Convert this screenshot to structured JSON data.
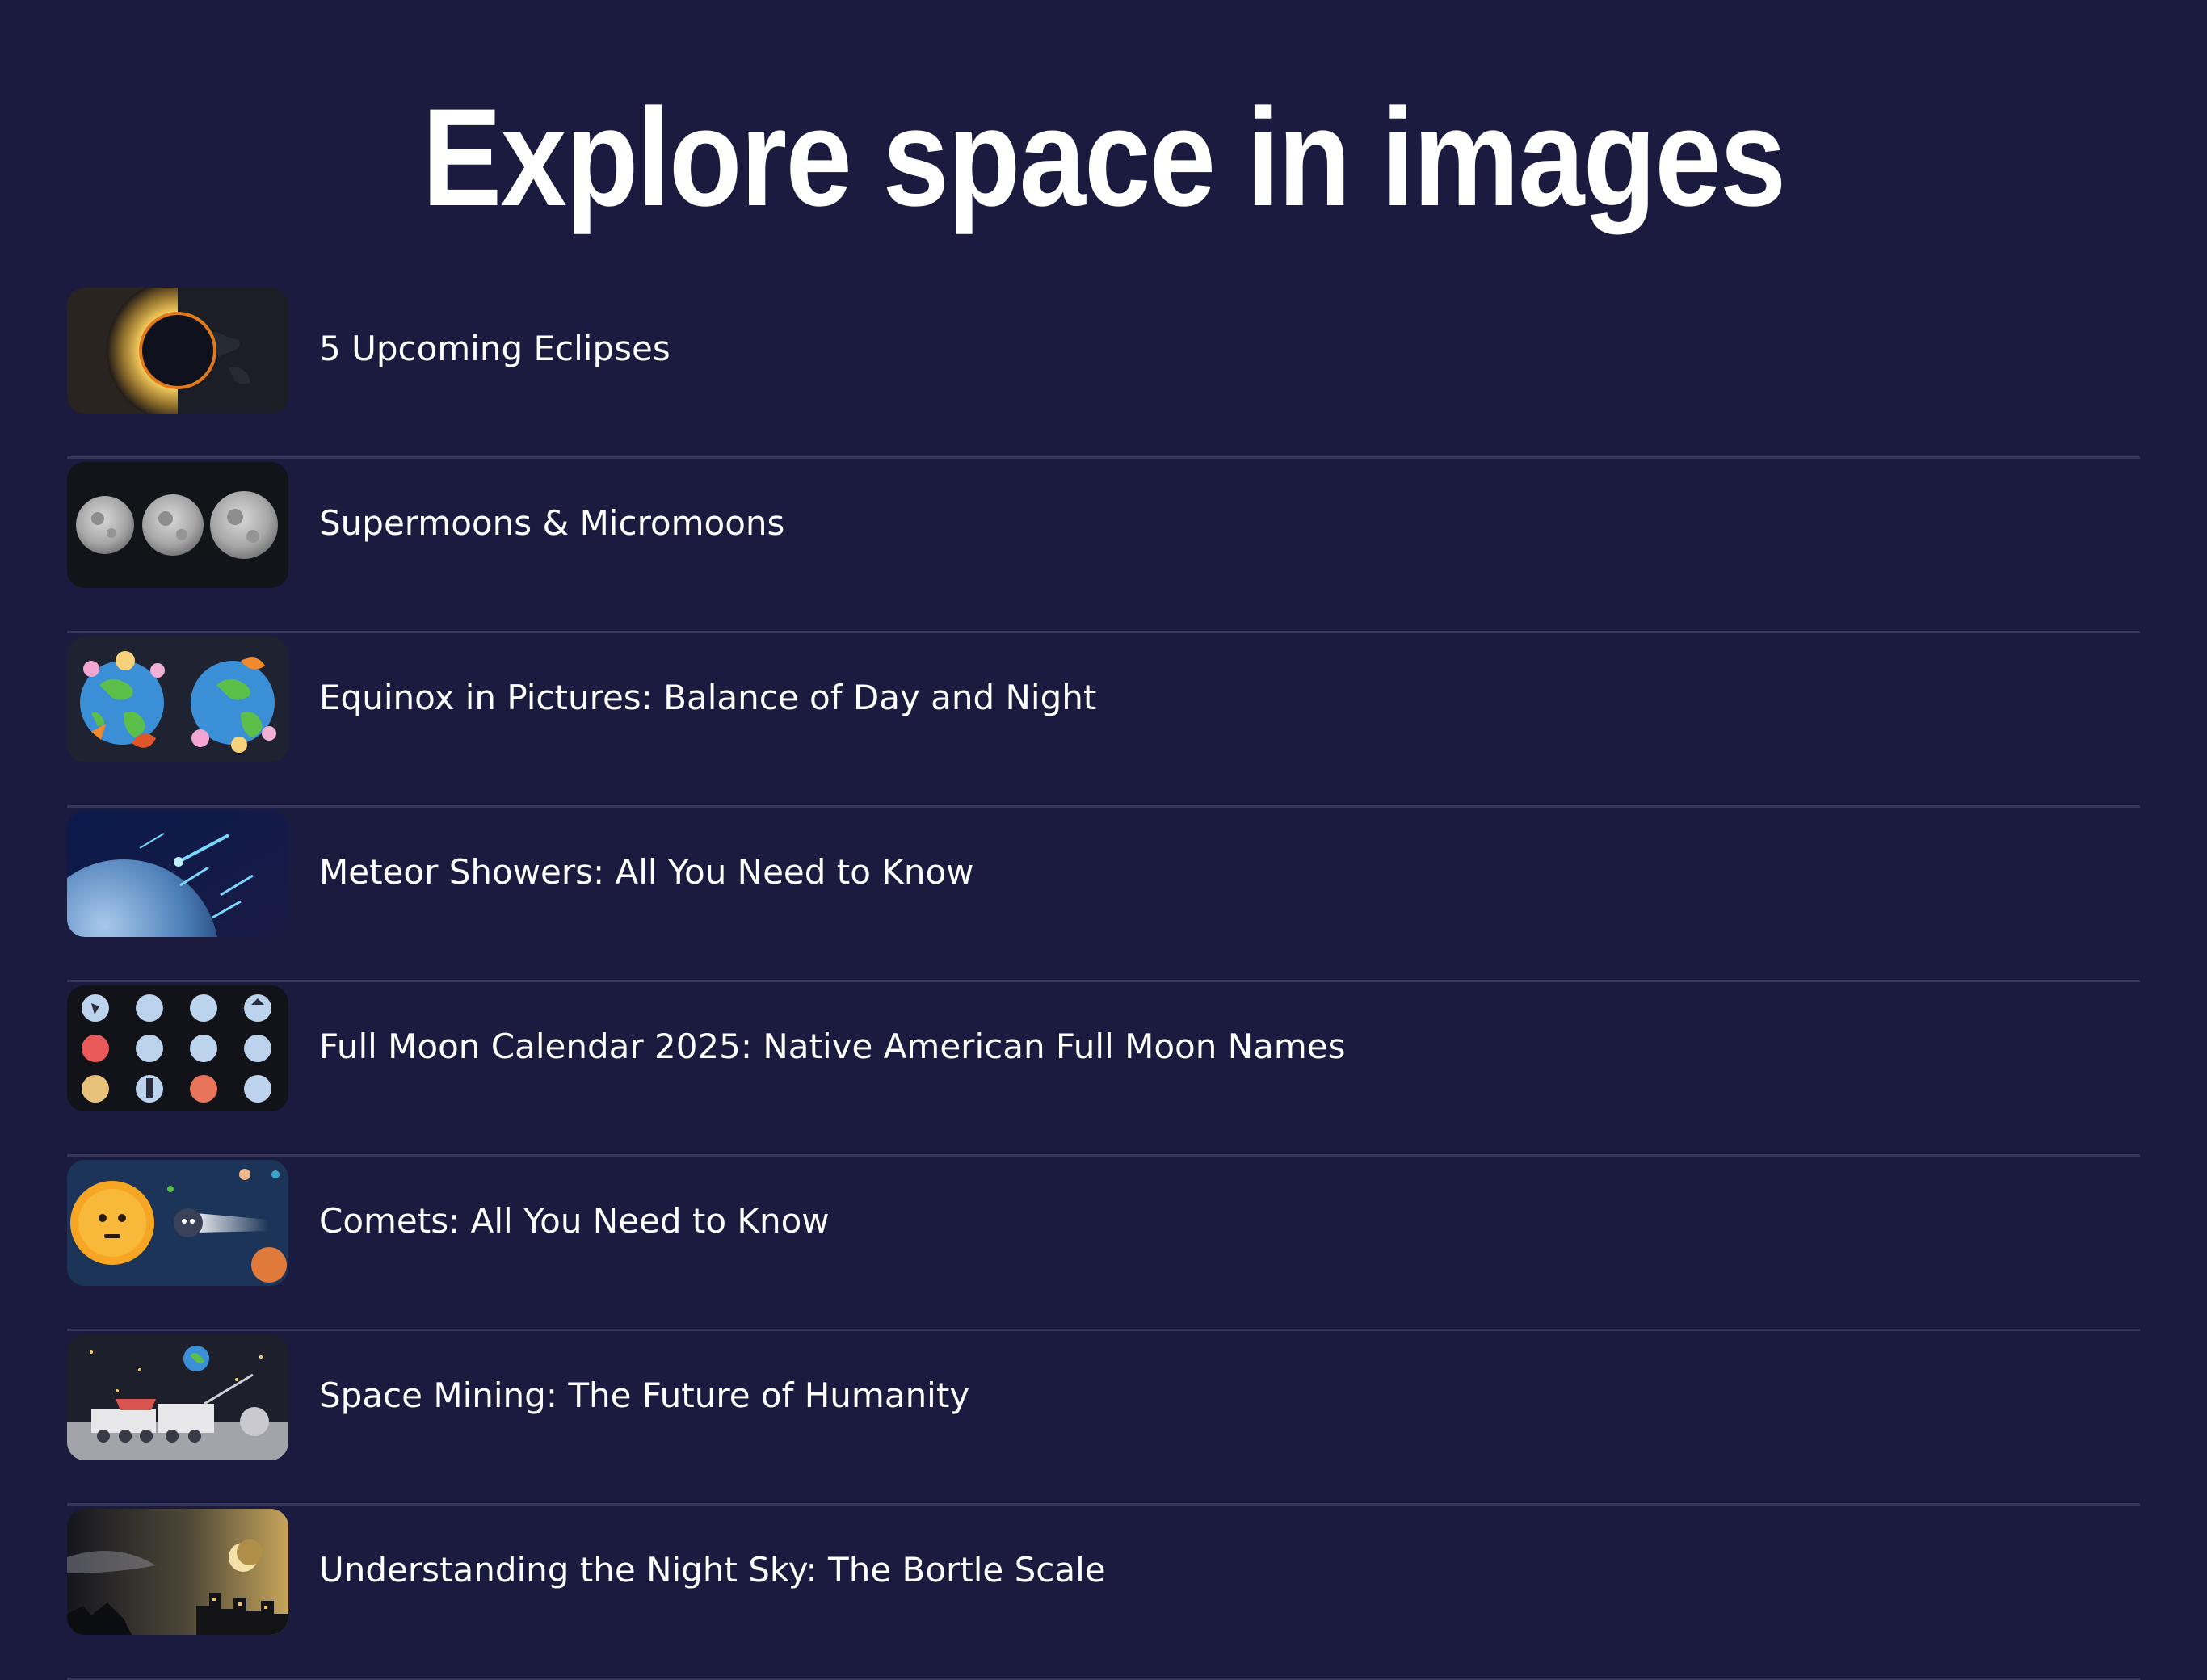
{
  "page": {
    "title": "Explore space in images"
  },
  "colors": {
    "background": "#1b1a3f",
    "divider": "#34365c",
    "text": "#ffffff"
  },
  "articles": [
    {
      "label": "5 Upcoming Eclipses",
      "icon": "solar-eclipse-icon"
    },
    {
      "label": "Supermoons & Micromoons",
      "icon": "three-moons-icon"
    },
    {
      "label": "Equinox in Pictures: Balance of Day and Night",
      "icon": "earth-equinox-icon"
    },
    {
      "label": "Meteor Showers: All You Need to Know",
      "icon": "meteor-shower-icon"
    },
    {
      "label": "Full Moon Calendar 2025: Native American Full Moon Names",
      "icon": "full-moon-grid-icon"
    },
    {
      "label": "Comets: All You Need to Know",
      "icon": "comet-sun-icon"
    },
    {
      "label": "Space Mining: The Future of Humanity",
      "icon": "lunar-mining-icon"
    },
    {
      "label": "Understanding the Night Sky: The Bortle Scale",
      "icon": "night-sky-city-icon"
    }
  ]
}
